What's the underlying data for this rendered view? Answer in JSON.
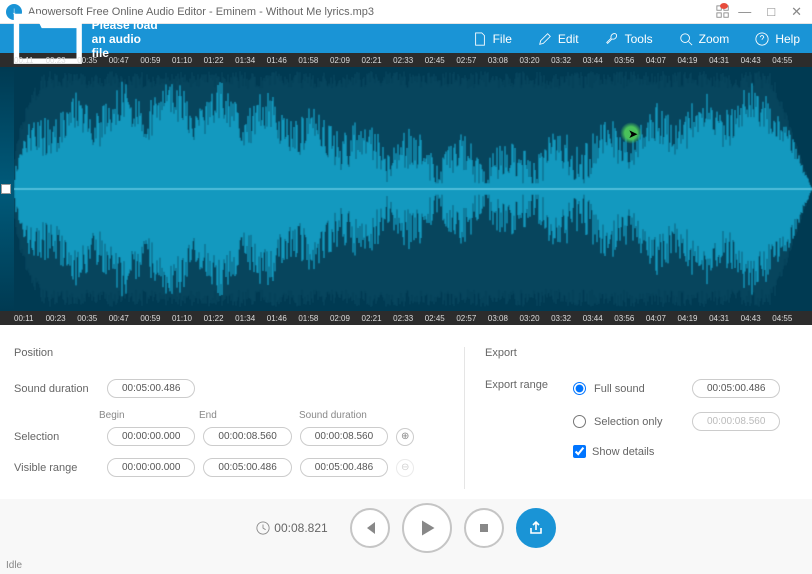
{
  "titlebar": {
    "app_name": "Apowersoft Free Online Audio Editor",
    "file_name": "Eminem - Without Me lyrics.mp3"
  },
  "toolbar": {
    "prompt": "Please load an audio file",
    "file": "File",
    "edit": "Edit",
    "tools": "Tools",
    "zoom": "Zoom",
    "help": "Help"
  },
  "ruler_ticks": [
    "00:11",
    "00:23",
    "00:35",
    "00:47",
    "00:59",
    "01:10",
    "01:22",
    "01:34",
    "01:46",
    "01:58",
    "02:09",
    "02:21",
    "02:33",
    "02:45",
    "02:57",
    "03:08",
    "03:20",
    "03:32",
    "03:44",
    "03:56",
    "04:07",
    "04:19",
    "04:31",
    "04:43",
    "04:55"
  ],
  "position": {
    "heading": "Position",
    "sound_duration_label": "Sound duration",
    "sound_duration": "00:05:00.486",
    "begin_label": "Begin",
    "end_label": "End",
    "sd_label": "Sound duration",
    "selection_label": "Selection",
    "sel_begin": "00:00:00.000",
    "sel_end": "00:00:08.560",
    "sel_dur": "00:00:08.560",
    "visible_label": "Visible range",
    "vis_begin": "00:00:00.000",
    "vis_end": "00:05:00.486",
    "vis_dur": "00:05:00.486"
  },
  "export": {
    "heading": "Export",
    "range_label": "Export range",
    "full_sound": "Full sound",
    "full_value": "00:05:00.486",
    "selection_only": "Selection only",
    "selection_value": "00:00:08.560",
    "show_details": "Show details"
  },
  "playback": {
    "time": "00:08.821"
  },
  "status": "Idle"
}
